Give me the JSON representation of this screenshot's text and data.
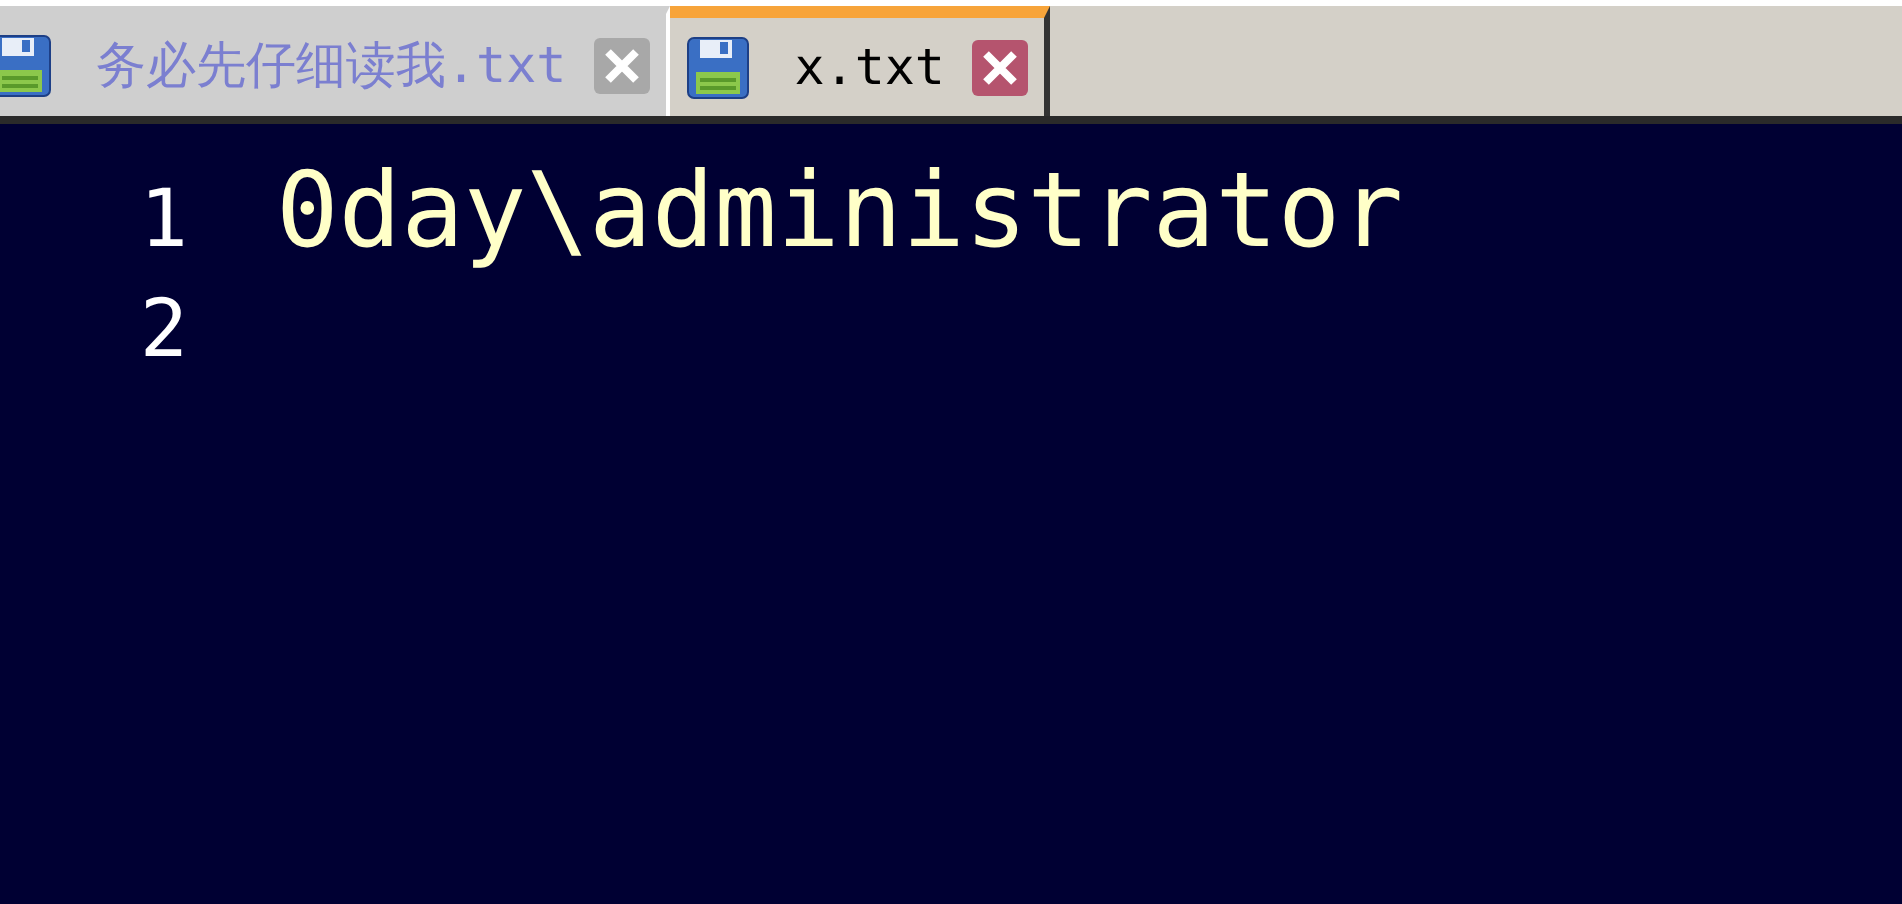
{
  "tabs": [
    {
      "label": "务必先仔细读我.txt",
      "selected": false
    },
    {
      "label": "x.txt",
      "selected": true
    }
  ],
  "editor": {
    "lines": [
      {
        "number": "1",
        "text": "0day\\administrator"
      },
      {
        "number": "2"
      }
    ]
  }
}
